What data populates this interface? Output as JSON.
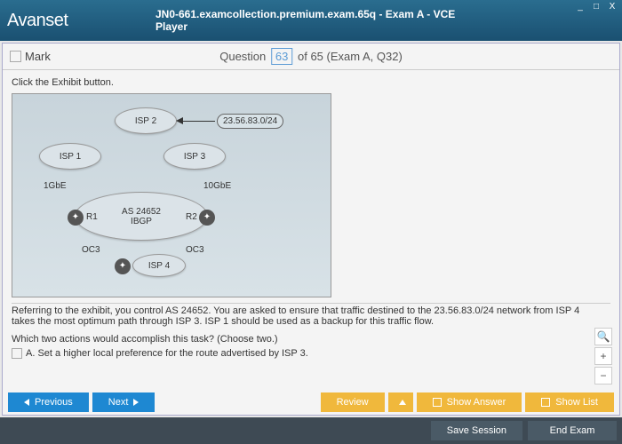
{
  "window": {
    "logo": "Avanset",
    "title": "JN0-661.examcollection.premium.exam.65q - Exam A - VCE Player",
    "min": "_",
    "max": "□",
    "close": "X"
  },
  "qbar": {
    "mark": "Mark",
    "word": "Question",
    "num": "63",
    "rest": " of 65 (Exam A, Q32)"
  },
  "body": {
    "click": "Click the Exhibit button.",
    "refer": "Referring to the exhibit, you control AS 24652. You are asked to ensure that traffic destined to the 23.56.83.0/24 network from ISP 4 takes the most optimum path through ISP 3. ISP 1 should be used as a backup for this traffic flow.",
    "which": "Which two actions would accomplish this task? (Choose two.)",
    "optA": "A.   Set a higher local preference for the route advertised by ISP 3."
  },
  "exhibit": {
    "isp1": "ISP 1",
    "isp2": "ISP 2",
    "isp3": "ISP 3",
    "isp4": "ISP 4",
    "net": "23.56.83.0/24",
    "as": "AS 24652",
    "ibgp": "IBGP",
    "r1": "R1",
    "r2": "R2",
    "g1": "1GbE",
    "g10": "10GbE",
    "oc3a": "OC3",
    "oc3b": "OC3"
  },
  "tools": {
    "search": "🔍",
    "plus": "+",
    "minus": "−"
  },
  "buttons": {
    "prev": "Previous",
    "next": "Next",
    "review": "Review",
    "showans": "Show Answer",
    "showlist": "Show List",
    "save": "Save Session",
    "end": "End Exam"
  }
}
